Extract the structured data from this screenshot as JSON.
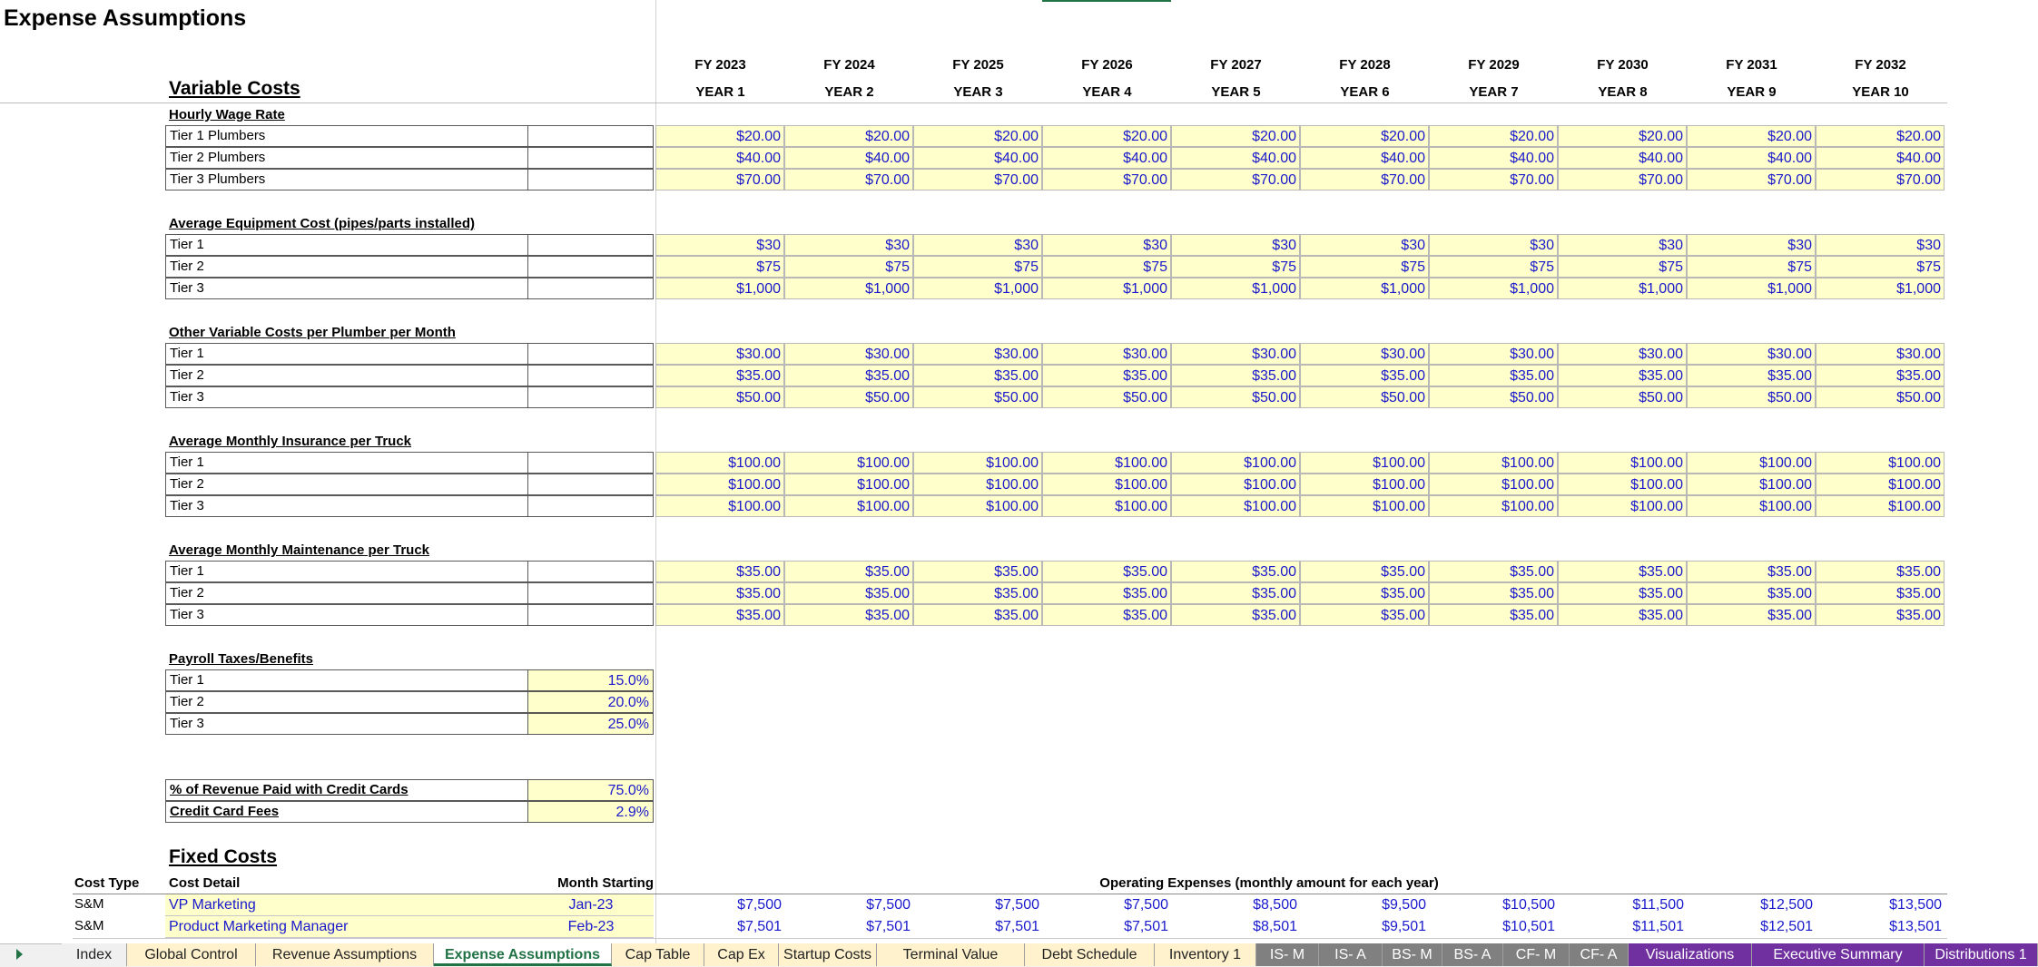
{
  "title": "Expense Assumptions",
  "years": [
    {
      "fy": "FY 2023",
      "yr": "YEAR 1"
    },
    {
      "fy": "FY 2024",
      "yr": "YEAR 2"
    },
    {
      "fy": "FY 2025",
      "yr": "YEAR 3"
    },
    {
      "fy": "FY 2026",
      "yr": "YEAR 4"
    },
    {
      "fy": "FY 2027",
      "yr": "YEAR 5"
    },
    {
      "fy": "FY 2028",
      "yr": "YEAR 6"
    },
    {
      "fy": "FY 2029",
      "yr": "YEAR 7"
    },
    {
      "fy": "FY 2030",
      "yr": "YEAR 8"
    },
    {
      "fy": "FY 2031",
      "yr": "YEAR 9"
    },
    {
      "fy": "FY 2032",
      "yr": "YEAR 10"
    }
  ],
  "variable_costs_title": "Variable Costs",
  "blocks": [
    {
      "label": "Hourly Wage Rate",
      "rows": [
        {
          "name": "Tier 1 Plumbers",
          "value": "$20.00"
        },
        {
          "name": "Tier 2 Plumbers",
          "value": "$40.00"
        },
        {
          "name": "Tier 3 Plumbers",
          "value": "$70.00"
        }
      ]
    },
    {
      "label": "Average Equipment Cost (pipes/parts installed)",
      "rows": [
        {
          "name": "Tier 1",
          "value": "$30"
        },
        {
          "name": "Tier 2",
          "value": "$75"
        },
        {
          "name": "Tier 3",
          "value": "$1,000"
        }
      ]
    },
    {
      "label": "Other Variable Costs per Plumber per Month",
      "rows": [
        {
          "name": "Tier 1",
          "value": "$30.00"
        },
        {
          "name": "Tier 2",
          "value": "$35.00"
        },
        {
          "name": "Tier 3",
          "value": "$50.00"
        }
      ]
    },
    {
      "label": "Average Monthly Insurance per Truck",
      "rows": [
        {
          "name": "Tier 1",
          "value": "$100.00"
        },
        {
          "name": "Tier 2",
          "value": "$100.00"
        },
        {
          "name": "Tier 3",
          "value": "$100.00"
        }
      ]
    },
    {
      "label": "Average Monthly Maintenance per Truck",
      "rows": [
        {
          "name": "Tier 1",
          "value": "$35.00"
        },
        {
          "name": "Tier 2",
          "value": "$35.00"
        },
        {
          "name": "Tier 3",
          "value": "$35.00"
        }
      ]
    }
  ],
  "payroll": {
    "label": "Payroll Taxes/Benefits",
    "rows": [
      {
        "name": "Tier 1",
        "value": "15.0%"
      },
      {
        "name": "Tier 2",
        "value": "20.0%"
      },
      {
        "name": "Tier 3",
        "value": "25.0%"
      }
    ]
  },
  "credit": [
    {
      "name": "% of Revenue Paid with Credit Cards",
      "value": "75.0%"
    },
    {
      "name": "Credit Card Fees",
      "value": "2.9%"
    }
  ],
  "fixed_costs_title": "Fixed Costs",
  "fixed_headers": {
    "cost_type": "Cost Type",
    "cost_detail": "Cost Detail",
    "month_starting": "Month Starting",
    "opex": "Operating Expenses (monthly amount for each year)"
  },
  "fixed_rows": [
    {
      "type": "S&M",
      "detail": "VP Marketing",
      "month": "Jan-23",
      "values": [
        "$7,500",
        "$7,500",
        "$7,500",
        "$7,500",
        "$8,500",
        "$9,500",
        "$10,500",
        "$11,500",
        "$12,500",
        "$13,500"
      ]
    },
    {
      "type": "S&M",
      "detail": "Product Marketing Manager",
      "month": "Feb-23",
      "values": [
        "$7,501",
        "$7,501",
        "$7,501",
        "$7,501",
        "$8,501",
        "$9,501",
        "$10,501",
        "$11,501",
        "$12,501",
        "$13,501"
      ]
    }
  ],
  "tabs": [
    {
      "label": "Index",
      "style": "normal"
    },
    {
      "label": "Global Control",
      "style": "yellow"
    },
    {
      "label": "Revenue Assumptions",
      "style": "yellow"
    },
    {
      "label": "Expense Assumptions",
      "style": "active"
    },
    {
      "label": "Cap Table",
      "style": "yellow"
    },
    {
      "label": "Cap Ex",
      "style": "yellow"
    },
    {
      "label": "Startup Costs",
      "style": "yellow"
    },
    {
      "label": "Terminal Value",
      "style": "yellow"
    },
    {
      "label": "Debt Schedule",
      "style": "yellow"
    },
    {
      "label": "Inventory 1",
      "style": "yellow"
    },
    {
      "label": "IS- M",
      "style": "gray"
    },
    {
      "label": "IS- A",
      "style": "gray"
    },
    {
      "label": "BS- M",
      "style": "gray"
    },
    {
      "label": "BS- A",
      "style": "gray"
    },
    {
      "label": "CF- M",
      "style": "gray"
    },
    {
      "label": "CF- A",
      "style": "gray"
    },
    {
      "label": "Visualizations",
      "style": "purple"
    },
    {
      "label": "Executive Summary",
      "style": "purple"
    },
    {
      "label": "Distributions 1",
      "style": "purple"
    }
  ],
  "colors": {
    "input_fill": "#ffffcc",
    "input_text": "#1a1acc",
    "active_tab": "#217346",
    "purple_tab": "#7030a0",
    "gray_tab": "#808080"
  }
}
